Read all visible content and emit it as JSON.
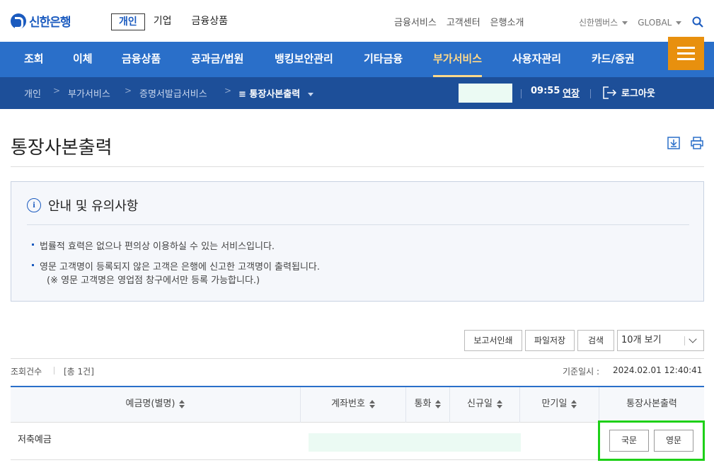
{
  "brand": {
    "name": "신한은행",
    "color": "#1b5bbf"
  },
  "segment_tabs": [
    "개인",
    "기업",
    "금융상품"
  ],
  "util_links": [
    "금융서비스",
    "고객센터",
    "은행소개"
  ],
  "util_links2": [
    "신한멤버스",
    "GLOBAL"
  ],
  "nav": [
    "조회",
    "이체",
    "금융상품",
    "공과금/법원",
    "뱅킹보안관리",
    "기타금융",
    "부가서비스",
    "사용자관리",
    "카드/증권"
  ],
  "breadcrumb": [
    "개인",
    "부가서비스",
    "증명서발급서비스",
    "통장사본출력"
  ],
  "session": {
    "time": "09:55",
    "extend": "연장",
    "logout": "로그아웃"
  },
  "page_title": "통장사본출력",
  "notice": {
    "title": "안내 및 유의사항",
    "items": [
      "법률적 효력은 없으나 편의상 이용하실 수 있는 서비스입니다.",
      "영문 고객명이 등록되지 않은 고객은 은행에 신고한 고객명이 출력됩니다.",
      "(※ 영문 고객명은 영업점 창구에서만 등록 가능합니다.)"
    ]
  },
  "actions": {
    "print_report": "보고서인쇄",
    "save_file": "파일저장",
    "search": "검색",
    "page_size": "10개 보기"
  },
  "summary": {
    "count_label": "조회건수",
    "count_value": "[총 1건]",
    "base_label": "기준일시 :",
    "base_value": "2024.02.01 12:40:41"
  },
  "table": {
    "headers": [
      "예금명(별명)",
      "계좌번호",
      "통화",
      "신규일",
      "만기일",
      "통장사본출력"
    ],
    "rows": [
      {
        "name": "저축예금",
        "kor": "국문",
        "eng": "영문"
      }
    ]
  },
  "colors": {
    "nav_bg": "#2a6fc9",
    "breadcrumb_bg": "#1d4f99",
    "menu_button": "#e8900e",
    "highlight": "#1ed018"
  }
}
